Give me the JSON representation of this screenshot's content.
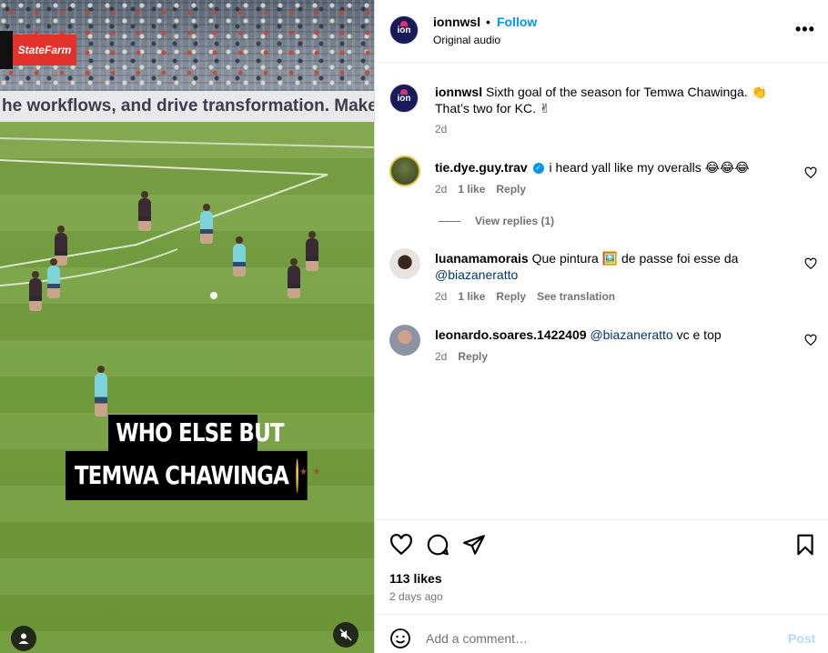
{
  "media": {
    "sponsor": "StateFarm",
    "banner_text": "he workflows, and drive transformation. Make a",
    "caption_line1": "WHO ELSE BUT",
    "caption_line2": "TEMWA CHAWINGA",
    "caption_emoji": "star-struck-emoji",
    "mute_icon": "muted-speaker-icon",
    "tag_icon": "user-tag-icon"
  },
  "header": {
    "logo_text": "ion",
    "username": "ionnwsl",
    "separator": "•",
    "follow_label": "Follow",
    "audio": "Original audio",
    "more_label": "•••"
  },
  "caption": {
    "username": "ionnwsl",
    "text": "Sixth goal of the season for Temwa Chawinga. 👏 That’s two for KC. ✌",
    "time": "2d"
  },
  "comments": [
    {
      "username": "tie.dye.guy.trav",
      "verified": true,
      "text": "i heard yall like my overalls 😂😂😂",
      "time": "2d",
      "likes": "1 like",
      "reply": "Reply",
      "view_replies": "View replies (1)"
    },
    {
      "username": "luanamamorais",
      "text_before": "Que pintura 🖼️ de passe foi esse da",
      "mention": "@biazaneratto",
      "time": "2d",
      "likes": "1 like",
      "reply": "Reply",
      "translation": "See translation"
    },
    {
      "username": "leonardo.soares.1422409",
      "mention": "@biazaneratto",
      "text_after": "vc e top",
      "time": "2d",
      "reply": "Reply"
    }
  ],
  "actions": {
    "like_icon": "heart-icon",
    "comment_icon": "comment-icon",
    "share_icon": "paper-plane-icon",
    "save_icon": "bookmark-icon",
    "likes": "113 likes",
    "posted": "2 days ago"
  },
  "composer": {
    "placeholder": "Add a comment…",
    "post_label": "Post"
  }
}
